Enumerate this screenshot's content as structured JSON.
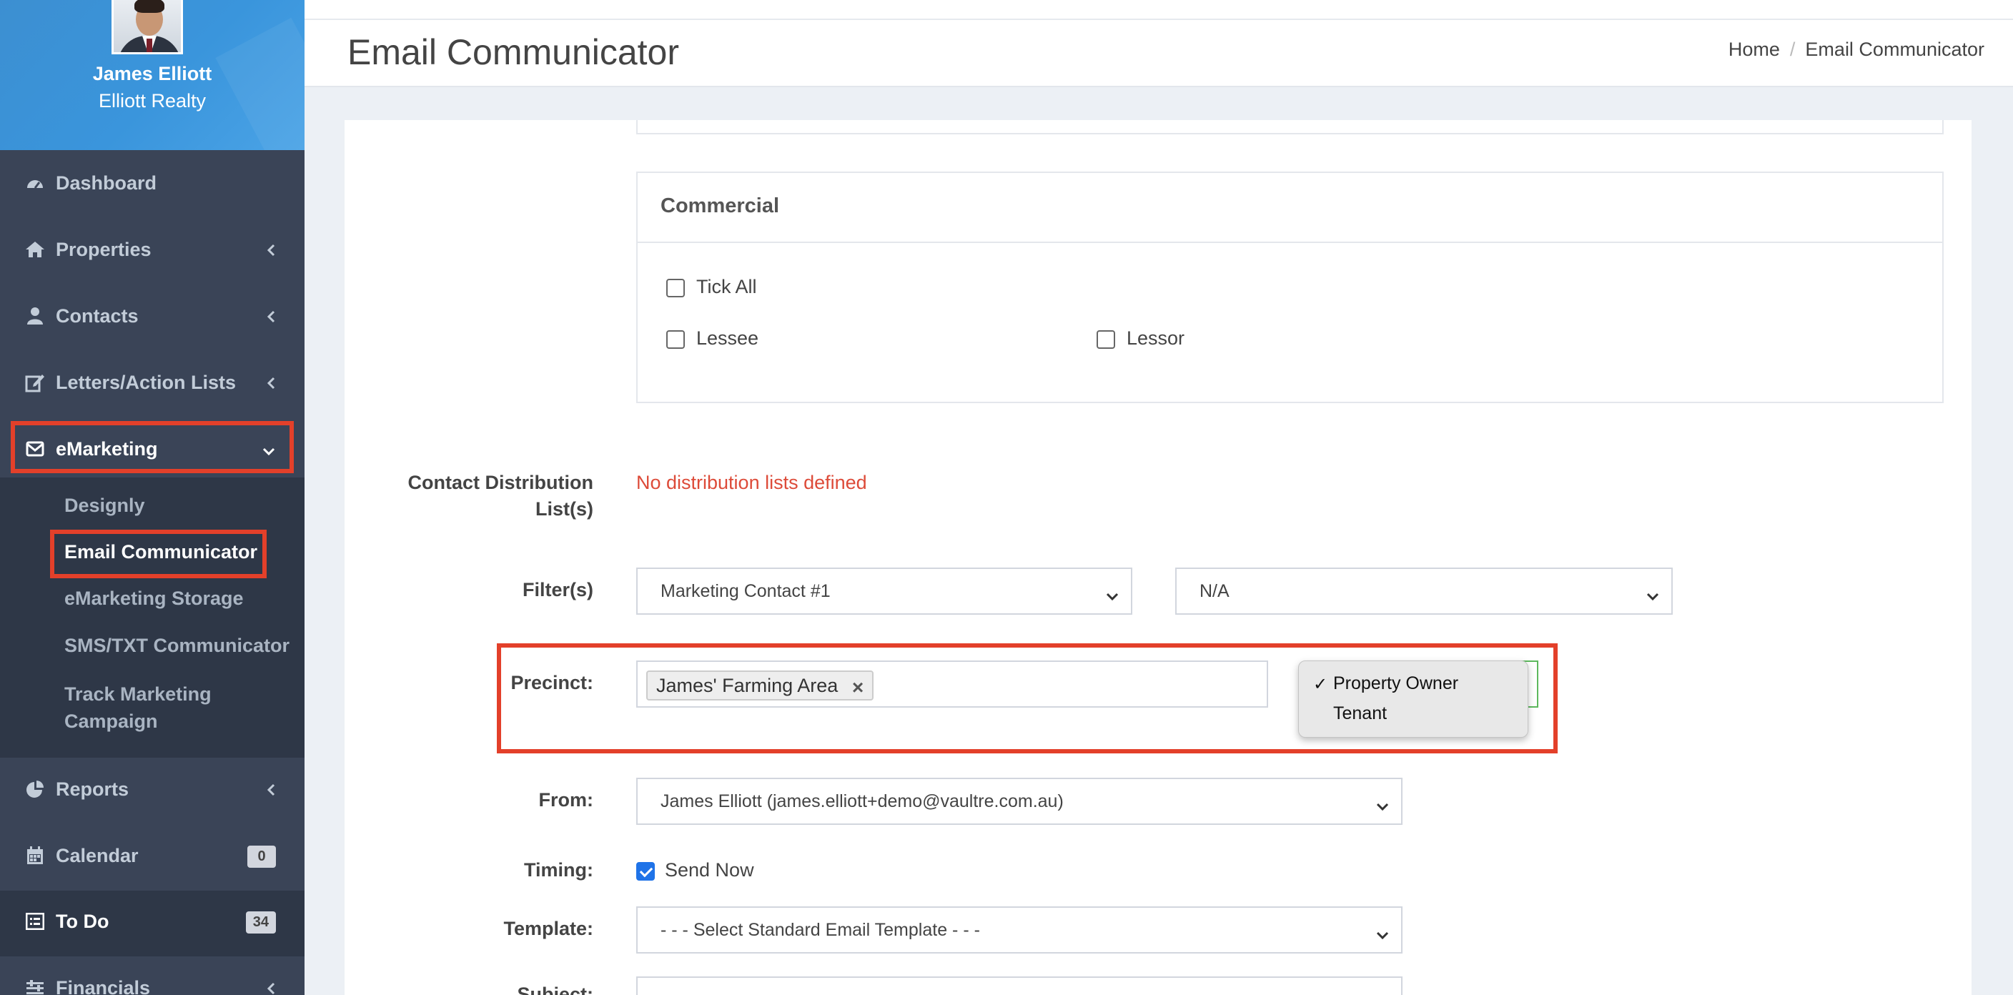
{
  "user": {
    "name": "James Elliott",
    "company": "Elliott Realty"
  },
  "sidebar": {
    "items": [
      {
        "label": "Dashboard",
        "icon": "dashboard-icon"
      },
      {
        "label": "Properties",
        "icon": "home-icon"
      },
      {
        "label": "Contacts",
        "icon": "user-icon"
      },
      {
        "label": "Letters/Action Lists",
        "icon": "edit-icon"
      },
      {
        "label": "eMarketing",
        "icon": "envelope-icon"
      },
      {
        "label": "Reports",
        "icon": "pie-chart-icon"
      },
      {
        "label": "Calendar",
        "icon": "calendar-icon",
        "badge": "0"
      },
      {
        "label": "To Do",
        "icon": "list-icon",
        "badge": "34"
      },
      {
        "label": "Financials",
        "icon": "sliders-icon"
      }
    ],
    "emarketing_sub": [
      {
        "label": "Designly"
      },
      {
        "label": "Email Communicator"
      },
      {
        "label": "eMarketing Storage"
      },
      {
        "label": "SMS/TXT Communicator"
      },
      {
        "label": "Track Marketing Campaign"
      }
    ]
  },
  "header": {
    "title": "Email Communicator",
    "breadcrumb": [
      "Home",
      "Email Communicator"
    ]
  },
  "commercial": {
    "title": "Commercial",
    "tick_all": "Tick All",
    "lessee": "Lessee",
    "lessor": "Lessor"
  },
  "form": {
    "distribution_label_1": "Contact Distribution",
    "distribution_label_2": "List(s)",
    "distribution_error": "No distribution lists defined",
    "filters_label": "Filter(s)",
    "filter1_value": "Marketing Contact #1",
    "filter2_value": "N/A",
    "precinct_label": "Precinct:",
    "precinct_tag": "James' Farming Area",
    "precinct_options": [
      "Property Owner",
      "Tenant"
    ],
    "from_label": "From:",
    "from_value": "James Elliott (james.elliott+demo@vaultre.com.au)",
    "timing_label": "Timing:",
    "send_now": "Send Now",
    "template_label": "Template:",
    "template_value": "- - - Select Standard Email Template - - -",
    "subject_label": "Subject:"
  },
  "colors": {
    "sidebar_bg": "#3a4457",
    "accent": "#3c8fd1",
    "highlight": "#e3402a",
    "error": "#dd4b39"
  }
}
